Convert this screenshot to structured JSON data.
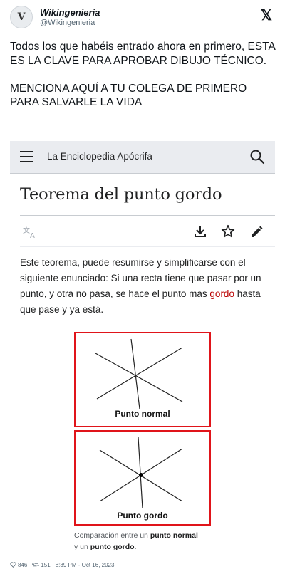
{
  "tweet": {
    "author_name": "Wikingenieria",
    "author_handle": "@Wikingenieria",
    "avatar_letter": "V",
    "platform_logo": "𝕏",
    "text": "Todos los que habéis entrado ahora en primero, ESTA ES LA CLAVE PARA APROBAR DIBUJO TÉCNICO.\n\nMENCIONA AQUÍ A TU COLEGA DE PRIMERO PARA SALVARLE LA VIDA",
    "likes": "846",
    "retweets": "151",
    "timestamp": "8:39 PM - Oct 16, 2023"
  },
  "wiki": {
    "site_name": "La Enciclopedia Apócrifa",
    "article_title": "Teorema del punto gordo",
    "body_before_link": "Este teorema, puede resumirse y simplificarse con el siguiente enunciado: Si una recta tiene que pasar por un punto, y otra no pasa, se hace el punto mas ",
    "body_link": "gordo",
    "body_after_link": " hasta que pase y ya está.",
    "figure": {
      "panel_normal_caption": "Punto normal",
      "panel_gordo_caption": "Punto gordo",
      "caption_prefix": "Comparación entre un ",
      "caption_bold_1": "punto normal",
      "caption_middle": " y un ",
      "caption_bold_2": "punto gordo",
      "caption_suffix": "."
    },
    "icons": [
      "menu-icon",
      "search-icon",
      "translate-icon",
      "download-icon",
      "star-icon",
      "edit-icon"
    ],
    "link_color": "#ba0000",
    "frame_color": "#e0141a"
  }
}
